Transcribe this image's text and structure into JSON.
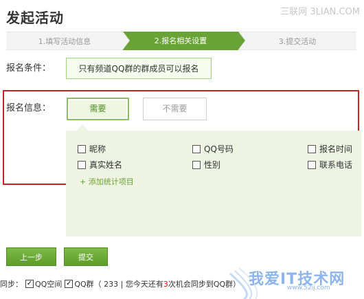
{
  "header": {
    "title": "发起活动",
    "watermark": "三联网 3LIAN.COM"
  },
  "steps": [
    {
      "label": "1.填写活动信息"
    },
    {
      "label": "2.报名相关设置"
    },
    {
      "label": "3.提交活动"
    }
  ],
  "condition": {
    "label": "报名条件：",
    "value": "只有频道QQ群的群成员可以报名"
  },
  "info": {
    "label": "报名信息：",
    "need_label": "需要",
    "noneed_label": "不需要",
    "options": [
      "昵称",
      "QQ号码",
      "报名时间",
      "真实姓名",
      "性别",
      "联系电话"
    ],
    "add_link": "+ 添加统计项目"
  },
  "buttons": {
    "prev": "上一步",
    "submit": "提交"
  },
  "sync": {
    "prefix": "同步：",
    "opt1": "QQ空间",
    "opt2": "QQ群（ 233 | 您今天还有",
    "count": "3",
    "suffix": "次机会同步到QQ群）"
  },
  "watermark_bottom": {
    "text": "我爱IT技术网",
    "url": "www.52ij.com"
  },
  "colors": {
    "accent": "#6aa335",
    "frame": "#cc1f1f",
    "panel": "#eef3e2"
  }
}
